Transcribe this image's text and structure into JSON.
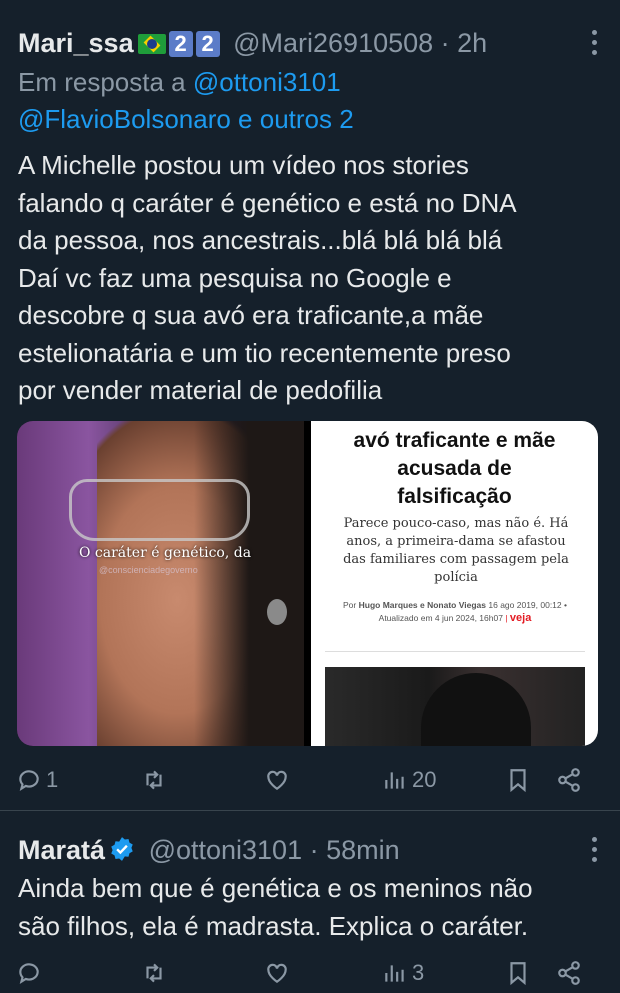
{
  "tweet1": {
    "display_name": "Mari_ssa",
    "name_badges": [
      "2",
      "2"
    ],
    "handle": "@Mari26910508",
    "time": "· 2h",
    "reply_prefix": "Em resposta a",
    "reply_to_1": "@ottoni3101",
    "reply_to_2": "@FlavioBolsonaro e outros 2",
    "text": "A Michelle postou um vídeo nos stories\nfalando q  caráter é genético e está no DNA\nda pessoa, nos ancestrais...blá blá blá blá\nDaí vc faz uma pesquisa no Google e\ndescobre q sua avó era traficante,a mãe\nestelionatária e um tio recentemente preso\npor vender material de pedofilia",
    "media_left": {
      "caption": "O caráter é genético, da",
      "watermark": "@conscienciadegoverno"
    },
    "media_right": {
      "headline": "avó traficante e mãe\nacusada de\nfalsificação",
      "subtitle": "Parece pouco-caso, mas não é. Há\nanos, a primeira-dama se afastou\ndas familiares com passagem pela\npolícia",
      "byline_prefix": "Por",
      "authors": "Hugo Marques e Nonato Viegas",
      "date": "16 ago 2019, 00:12 •",
      "updated": "Atualizado em 4 jun 2024, 16h07",
      "sep": "|",
      "brand": "veja"
    },
    "actions": {
      "replies": "1",
      "reposts": "",
      "likes": "",
      "views": "20"
    }
  },
  "tweet2": {
    "display_name": "Maratá",
    "handle": "@ottoni3101",
    "time": "· 58min",
    "text": "Ainda bem que é genética e os meninos não\nsão filhos, ela é madrasta. Explica o caráter.",
    "actions": {
      "replies": "",
      "reposts": "",
      "likes": "",
      "views": "3"
    }
  },
  "colors": {
    "background": "#15202b",
    "text": "#e7e9ea",
    "muted": "#8b98a5",
    "link": "#1d9bf0",
    "verified": "#1d9bf0",
    "veja_red": "#e31b23"
  },
  "icons": [
    "more-icon",
    "reply-icon",
    "repost-icon",
    "like-icon",
    "views-icon",
    "bookmark-icon",
    "share-icon",
    "verified-icon",
    "brazil-flag-icon"
  ]
}
